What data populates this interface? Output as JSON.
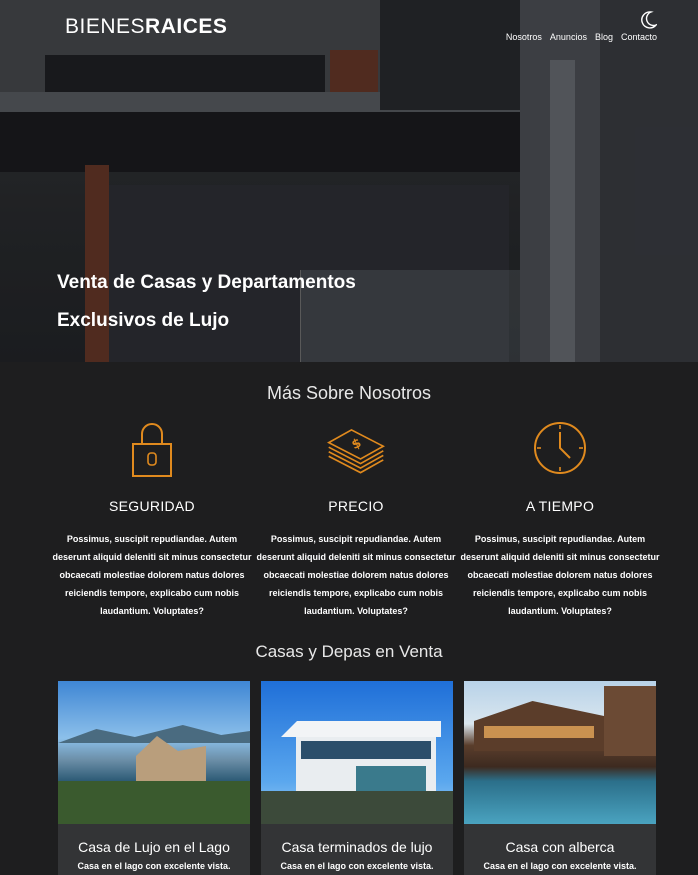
{
  "header": {
    "logo_light": "BIENES",
    "logo_bold": "RAICES",
    "theme_toggle_icon": "moon-icon",
    "nav": [
      "Nosotros",
      "Anuncios",
      "Blog",
      "Contacto"
    ]
  },
  "hero": {
    "title": "Venta de Casas y Departamentos Exclusivos de Lujo"
  },
  "about": {
    "title": "Más Sobre Nosotros",
    "features": [
      {
        "icon": "padlock-icon",
        "title": "SEGURIDAD",
        "text": "Possimus, suscipit repudiandae. Autem deserunt aliquid deleniti sit minus consectetur obcaecati molestiae dolorem natus dolores reiciendis tempore, explicabo cum nobis laudantium. Voluptates?"
      },
      {
        "icon": "money-stack-icon",
        "title": "PRECIO",
        "text": "Possimus, suscipit repudiandae. Autem deserunt aliquid deleniti sit minus consectetur obcaecati molestiae dolorem natus dolores reiciendis tempore, explicabo cum nobis laudantium. Voluptates?"
      },
      {
        "icon": "clock-icon",
        "title": "A TIEMPO",
        "text": "Possimus, suscipit repudiandae. Autem deserunt aliquid deleniti sit minus consectetur obcaecati molestiae dolorem natus dolores reiciendis tempore, explicabo cum nobis laudantium. Voluptates?"
      }
    ]
  },
  "listings": {
    "title": "Casas y Depas en Venta",
    "items": [
      {
        "title": "Casa de Lujo en el Lago",
        "desc": "Casa en el lago con excelente vista."
      },
      {
        "title": "Casa terminados de lujo",
        "desc": "Casa en el lago con excelente vista."
      },
      {
        "title": "Casa con alberca",
        "desc": "Casa en el lago con excelente vista."
      }
    ]
  },
  "colors": {
    "accent": "#e08a1e",
    "background": "#1e1e1f",
    "card": "#333436"
  }
}
